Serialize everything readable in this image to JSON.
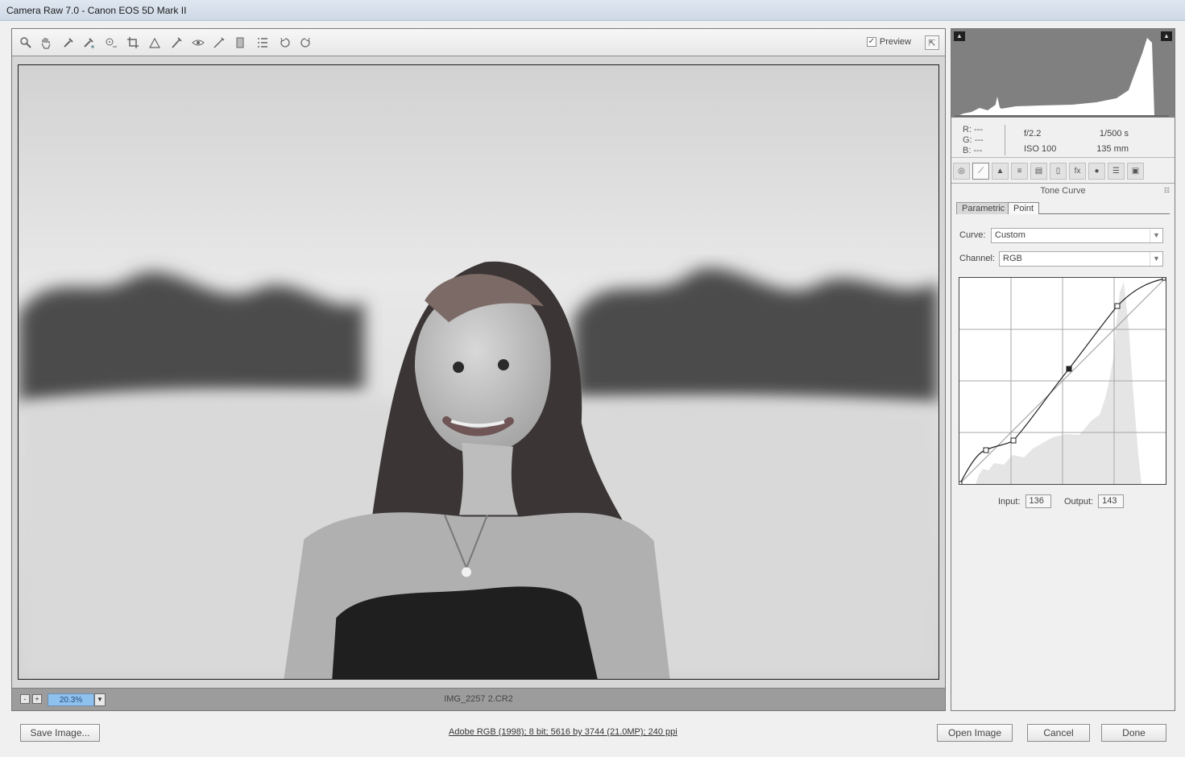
{
  "window": {
    "title": "Camera Raw 7.0  -  Canon EOS 5D Mark II"
  },
  "toolbar": {
    "tools": [
      {
        "name": "zoom-tool",
        "icon": "magnifier-icon"
      },
      {
        "name": "hand-tool",
        "icon": "hand-icon"
      },
      {
        "name": "white-balance-tool",
        "icon": "eyedropper-icon"
      },
      {
        "name": "color-sampler-tool",
        "icon": "color-sampler-icon"
      },
      {
        "name": "targeted-adjustment-tool",
        "icon": "target-icon"
      },
      {
        "name": "crop-tool",
        "icon": "crop-icon"
      },
      {
        "name": "straighten-tool",
        "icon": "straighten-icon"
      },
      {
        "name": "spot-removal-tool",
        "icon": "brush-icon"
      },
      {
        "name": "red-eye-tool",
        "icon": "eye-icon"
      },
      {
        "name": "adjustment-brush-tool",
        "icon": "brush-icon"
      },
      {
        "name": "graduated-filter-tool",
        "icon": "filter-icon"
      },
      {
        "name": "preferences-tool",
        "icon": "list-icon"
      },
      {
        "name": "rotate-left-tool",
        "icon": "rotate-left-icon"
      },
      {
        "name": "rotate-right-tool",
        "icon": "rotate-right-icon"
      }
    ],
    "preview_label": "Preview",
    "preview_checked": true,
    "fullscreen_icon": "fullscreen-icon"
  },
  "status": {
    "zoom_out_label": "-",
    "zoom_in_label": "+",
    "zoom_level": "20.3%",
    "filename": "IMG_2257 2.CR2"
  },
  "histogram": {
    "shadow_clip_icon": "shadow-clipping-icon",
    "highlight_clip_icon": "highlight-clipping-icon"
  },
  "readout": {
    "r_label": "R:",
    "r_value": "---",
    "g_label": "G:",
    "g_value": "---",
    "b_label": "B:",
    "b_value": "---",
    "aperture": "f/2.2",
    "shutter": "1/500 s",
    "iso": "ISO 100",
    "focal_length": "135 mm"
  },
  "panel": {
    "title": "Tone Curve",
    "menu_icon": "panel-menu-icon",
    "tabs": [
      "Basic",
      "Tone Curve",
      "Detail",
      "HSL / Grayscale",
      "Split Toning",
      "Lens Corrections",
      "Effects",
      "Camera Calibration",
      "Presets",
      "Snapshots"
    ],
    "active_tab": "Tone Curve",
    "subtabs": {
      "parametric": "Parametric",
      "point": "Point",
      "active": "Point"
    }
  },
  "curve": {
    "curve_label": "Curve:",
    "curve_value": "Custom",
    "channel_label": "Channel:",
    "channel_value": "RGB",
    "input_label": "Input:",
    "input_value": "136",
    "output_label": "Output:",
    "output_value": "143"
  },
  "footer": {
    "save_image": "Save Image...",
    "workflow": "Adobe RGB (1998); 8 bit; 5616 by 3744 (21.0MP); 240 ppi",
    "open_image": "Open Image",
    "cancel": "Cancel",
    "done": "Done"
  }
}
